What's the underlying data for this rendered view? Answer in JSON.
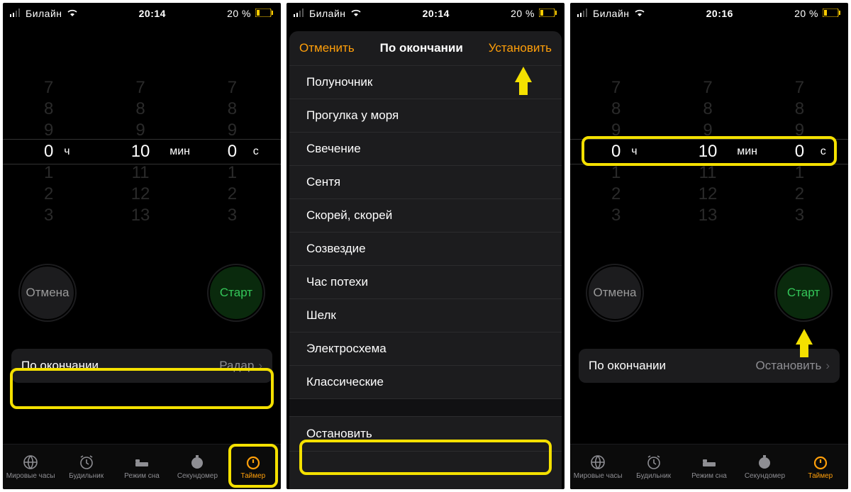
{
  "status": {
    "carrier": "Билайн",
    "time1": "20:14",
    "time2": "20:14",
    "time3": "20:16",
    "battery": "20 %"
  },
  "picker": {
    "hours": "0",
    "minutes": "10",
    "seconds": "0",
    "unit_h": "ч",
    "unit_m": "мин",
    "unit_s": "с",
    "faded_above": [
      "7",
      "8",
      "9"
    ],
    "faded_below_h": [
      "1",
      "2",
      "3"
    ],
    "faded_below_m": [
      "11",
      "12",
      "13"
    ],
    "faded_below_s": [
      "1",
      "2",
      "3"
    ]
  },
  "buttons": {
    "cancel": "Отмена",
    "start": "Старт"
  },
  "endrow": {
    "label": "По окончании",
    "value1": "Радар",
    "value3": "Остановить"
  },
  "tabs": {
    "world": "Мировые часы",
    "alarm": "Будильник",
    "sleep": "Режим сна",
    "stopwatch": "Секундомер",
    "timer": "Таймер"
  },
  "sheet": {
    "cancel": "Отменить",
    "title": "По окончании",
    "set": "Установить",
    "sounds": [
      "Полуночник",
      "Прогулка у моря",
      "Свечение",
      "Сентя",
      "Скорей, скорей",
      "Созвездие",
      "Час потехи",
      "Шелк",
      "Электросхема",
      "Классические"
    ],
    "stop": "Остановить"
  }
}
